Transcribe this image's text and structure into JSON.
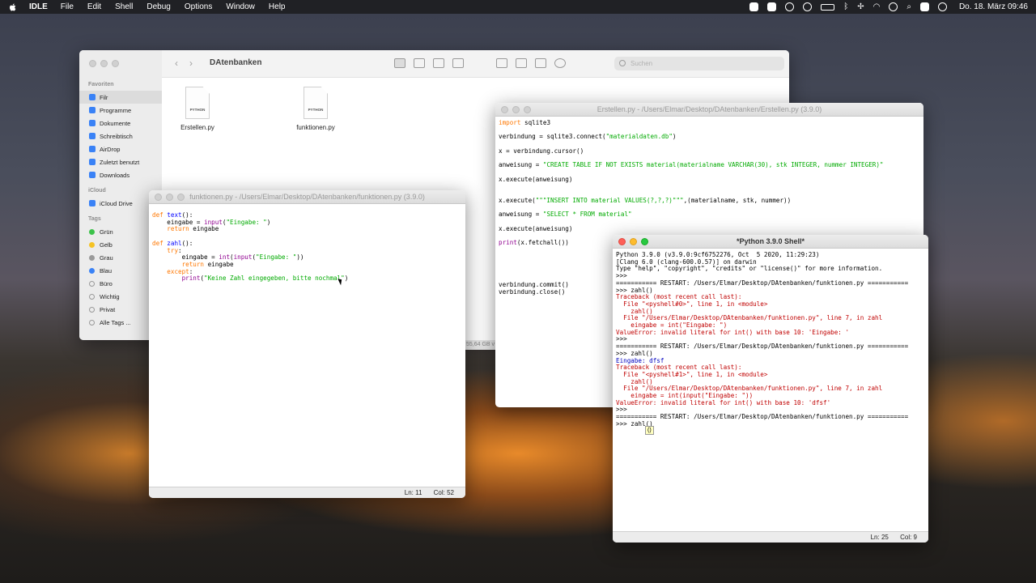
{
  "menubar": {
    "app": "IDLE",
    "items": [
      "File",
      "Edit",
      "Shell",
      "Debug",
      "Options",
      "Window",
      "Help"
    ],
    "datetime": "Do. 18. März  09:46"
  },
  "finder": {
    "title": "DAtenbanken",
    "search_placeholder": "Suchen",
    "sidebar": {
      "favorites_header": "Favoriten",
      "favorites": [
        "Filr",
        "Programme",
        "Dokumente",
        "Schreibtisch",
        "AirDrop",
        "Zuletzt benutzt",
        "Downloads"
      ],
      "icloud_header": "iCloud",
      "icloud": [
        "iCloud Drive"
      ],
      "tags_header": "Tags",
      "tags": [
        {
          "label": "Grün",
          "color": "#3cc24a"
        },
        {
          "label": "Gelb",
          "color": "#f5c325"
        },
        {
          "label": "Grau",
          "color": "#9a9a9a"
        },
        {
          "label": "Blau",
          "color": "#3a82f6"
        },
        {
          "label": "Büro",
          "color": "none"
        },
        {
          "label": "Wichtig",
          "color": "none"
        },
        {
          "label": "Privat",
          "color": "none"
        },
        {
          "label": "Alle Tags ...",
          "color": "none"
        }
      ]
    },
    "files": [
      {
        "name": "Erstellen.py",
        "type": "PYTHON"
      },
      {
        "name": "funktionen.py",
        "type": "PYTHON"
      }
    ],
    "partial_status": "55,64 GB v"
  },
  "editor_erstellen": {
    "title": "Erstellen.py - /Users/Elmar/Desktop/DAtenbanken/Erstellen.py (3.9.0)",
    "lines": [
      "import sqlite3",
      "",
      "verbindung = sqlite3.connect(\"materialdaten.db\")",
      "",
      "x = verbindung.cursor()",
      "",
      "anweisung = \"CREATE TABLE IF NOT EXISTS material(materialname VARCHAR(30), stk INTEGER, nummer INTEGER)\"",
      "",
      "x.execute(anweisung)",
      "",
      "",
      "x.execute(\"\"\"INSERT INTO material VALUES(?,?,?)\"\"\",(materialname, stk, nummer))",
      "",
      "anweisung = \"SELECT * FROM material\"",
      "",
      "x.execute(anweisung)",
      "",
      "print(x.fetchall())",
      "",
      "",
      "",
      "",
      "",
      "verbindung.commit()",
      "verbindung.close()"
    ]
  },
  "editor_funktionen": {
    "title": "funktionen.py - /Users/Elmar/Desktop/DAtenbanken/funktionen.py (3.9.0)",
    "lines": [
      "def text():",
      "    eingabe = input(\"Eingabe: \")",
      "    return eingabe",
      "",
      "def zahl():",
      "    try:",
      "        eingabe = int(input(\"Eingabe: \"))",
      "        return eingabe",
      "    except:",
      "        print(\"Keine Zahl eingegeben, bitte nochmal\")"
    ],
    "status_ln": "Ln: 11",
    "status_col": "Col: 52"
  },
  "shell": {
    "title": "*Python 3.9.0 Shell*",
    "lines": [
      "Python 3.9.0 (v3.9.0:9cf6752276, Oct  5 2020, 11:29:23)",
      "[Clang 6.0 (clang-600.0.57)] on darwin",
      "Type \"help\", \"copyright\", \"credits\" or \"license()\" for more information.",
      ">>>",
      "=========== RESTART: /Users/Elmar/Desktop/DAtenbanken/funktionen.py ===========",
      ">>> zahl()",
      "Traceback (most recent call last):",
      "  File \"<pyshell#0>\", line 1, in <module>",
      "    zahl()",
      "  File \"/Users/Elmar/Desktop/DAtenbanken/funktionen.py\", line 7, in zahl",
      "    eingabe = int(\"Eingabe: \")",
      "ValueError: invalid literal for int() with base 10: 'Eingabe: '",
      ">>>",
      "=========== RESTART: /Users/Elmar/Desktop/DAtenbanken/funktionen.py ===========",
      ">>> zahl()",
      "Eingabe: dfsf",
      "Traceback (most recent call last):",
      "  File \"<pyshell#1>\", line 1, in <module>",
      "    zahl()",
      "  File \"/Users/Elmar/Desktop/DAtenbanken/funktionen.py\", line 7, in zahl",
      "    eingabe = int(input(\"Eingabe: \"))",
      "ValueError: invalid literal for int() with base 10: 'dfsf'",
      ">>>",
      "=========== RESTART: /Users/Elmar/Desktop/DAtenbanken/funktionen.py ===========",
      ">>> zahl()"
    ],
    "calltip": "()",
    "status_ln": "Ln: 25",
    "status_col": "Col: 9"
  }
}
